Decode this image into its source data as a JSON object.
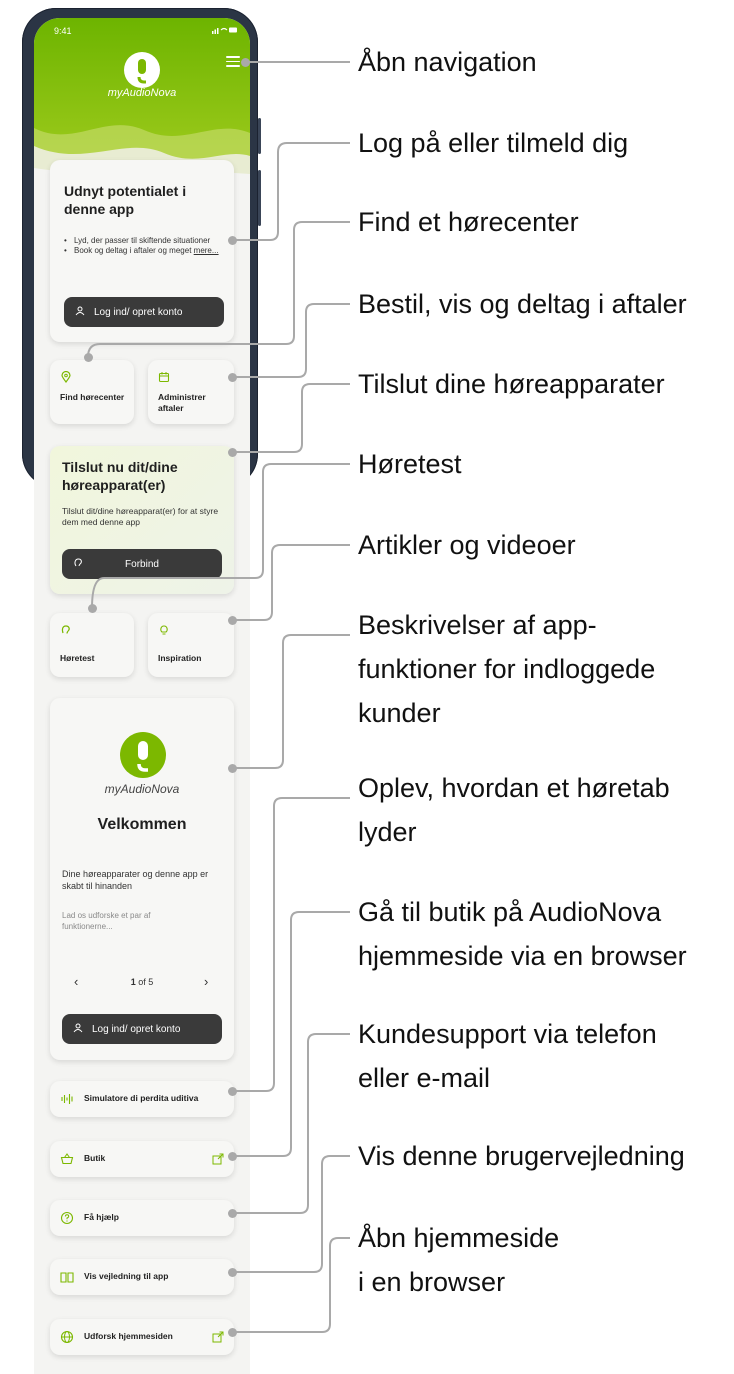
{
  "status_bar": {
    "time": "9:41",
    "icons": "..ll ≈ ▬"
  },
  "app": {
    "logo_text": "myAudioNova"
  },
  "promo_card": {
    "title": "Udnyt potentialet i denne app",
    "bullets": [
      "Lyd, der passer til skiftende situationer",
      "Book og deltag i aftaler og meget"
    ],
    "more_link": "mere...",
    "button_label": "Log ind/ opret konto"
  },
  "quick_cards": [
    {
      "label": "Find høre­center",
      "icon": "map-pin-icon"
    },
    {
      "label": "Administrer aftaler",
      "icon": "calendar-icon"
    }
  ],
  "connect_card": {
    "title": "Tilslut nu dit/dine høreapparat(er)",
    "text": "Tilslut dit/dine høreapparat(er) for at styre dem med denne app",
    "button_label": "Forbind"
  },
  "quick_cards_2": [
    {
      "label": "Høretest",
      "icon": "ear-icon"
    },
    {
      "label": "Inspiration",
      "icon": "lightbulb-icon"
    }
  ],
  "welcome_card": {
    "logo_text": "myAudioNova",
    "title": "Velkommen",
    "text": "Dine høreapparater og denne app er skabt til hinanden",
    "subtext": "Lad os udforske et par af funktionerne...",
    "page_current": "1",
    "page_rest": "of 5",
    "button_label": "Log ind/ opret konto"
  },
  "list_items": [
    {
      "label": "Simulatore di perdita uditiva",
      "icon": "sound-wave-icon"
    },
    {
      "label": "Butik",
      "icon": "basket-icon"
    },
    {
      "label": "Få hjælp",
      "icon": "help-circle-icon"
    },
    {
      "label": "Vis vejledning til app",
      "icon": "book-icon"
    },
    {
      "label": "Udforsk hjemmesiden",
      "icon": "globe-icon"
    }
  ],
  "callouts": [
    "Åbn navigation",
    "Log på eller tilmeld dig",
    "Find et hørecenter",
    "Bestil, vis og deltag i aftaler",
    "Tilslut dine høreapparater",
    "Høretest",
    "Artikler og videoer",
    "Beskrivelser af app-\nfunktioner for indloggede\nkunder",
    "Oplev, hvordan et høretab\nlyder",
    "Gå til butik på AudioNova\nhjemmeside via en browser",
    "Kundesupport via telefon\neller e-mail",
    "Vis denne brugervejledning",
    "Åbn hjemmeside\ni en browser"
  ],
  "colors": {
    "brand_green": "#7cb800",
    "dark_button": "#3a3a3a",
    "callout_line": "#a9a9a9"
  }
}
